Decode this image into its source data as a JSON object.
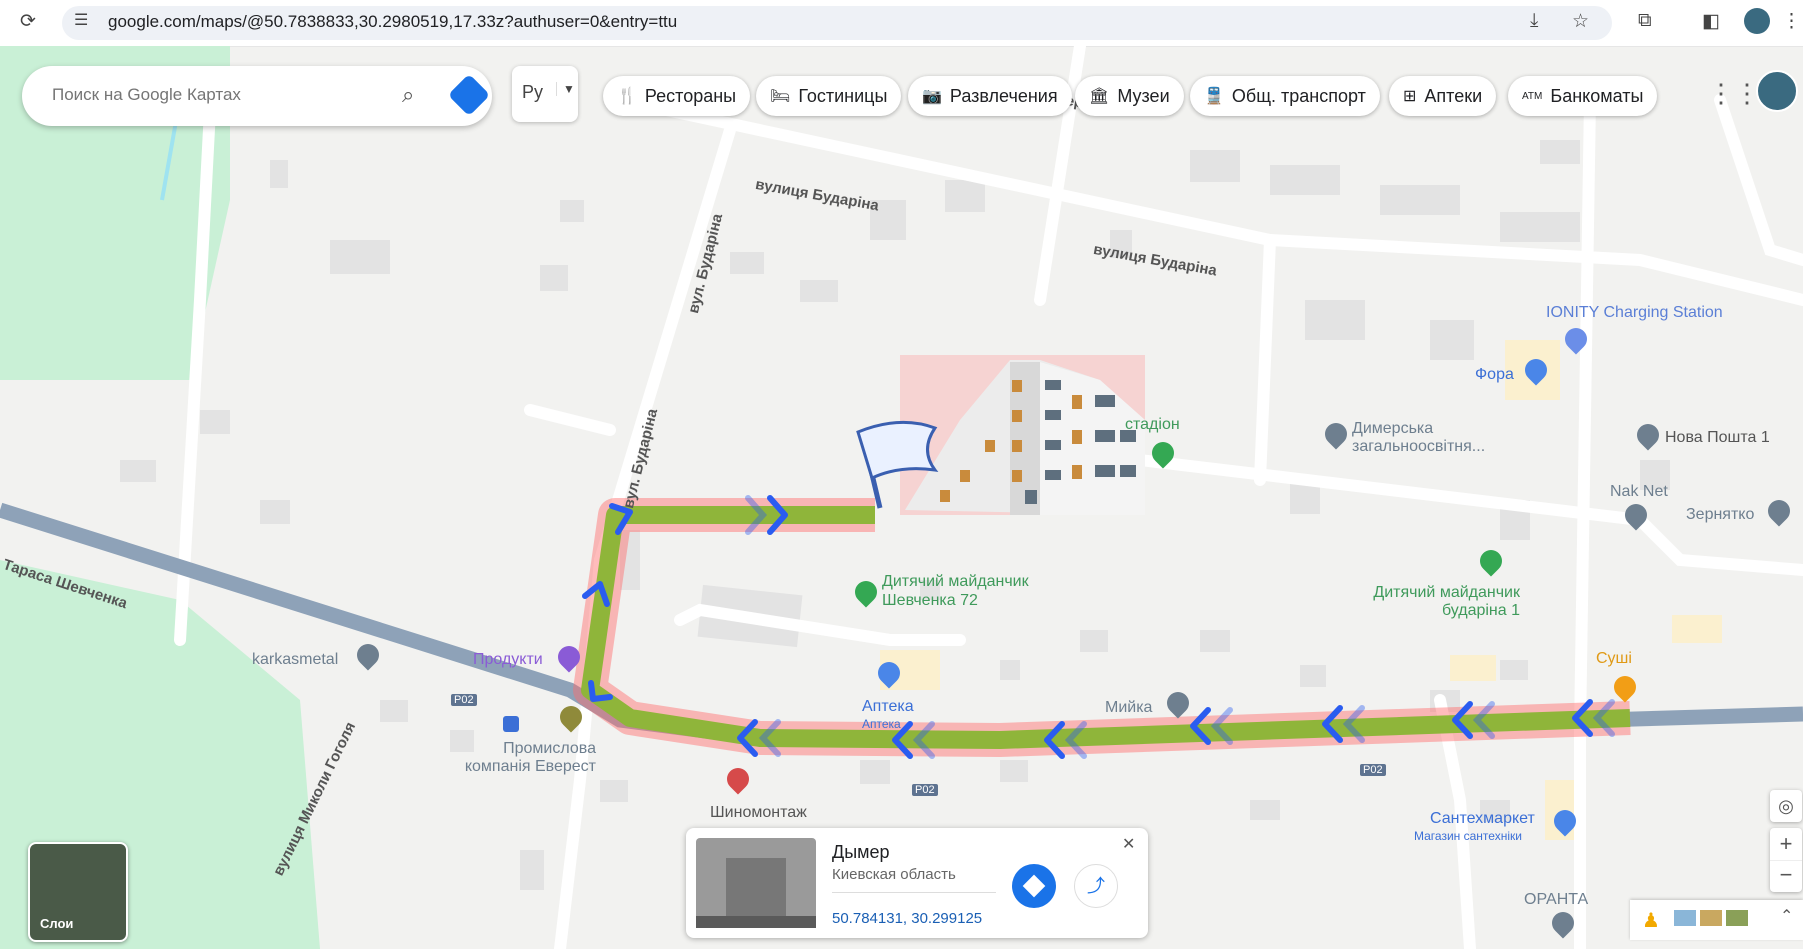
{
  "browser": {
    "url": "google.com/maps/@50.7838833,30.2980519,17.33z?authuser=0&entry=ttu"
  },
  "search": {
    "placeholder": "Поиск на Google Картах"
  },
  "lang_selector": "Ру",
  "chips": [
    {
      "icon": "utensils-icon",
      "label": "Рестораны"
    },
    {
      "icon": "bed-icon",
      "label": "Гостиницы"
    },
    {
      "icon": "camera-icon",
      "label": "Развлечения"
    },
    {
      "icon": "museum-icon",
      "label": "Музеи"
    },
    {
      "icon": "bus-icon",
      "label": "Общ. транспорт"
    },
    {
      "icon": "pharmacy-icon",
      "label": "Аптеки"
    },
    {
      "icon": "atm-icon",
      "label": "Банкоматы"
    }
  ],
  "roads": {
    "budarina_1": "вулиця Бударіна",
    "budarina_2": "вулиця Бударіна",
    "budarina_v1": "вул. Бударіна",
    "budarina_v2": "вул. Бударіна",
    "shevchenka": "Тараса Шевченка",
    "gogolya": "вулиця Миколи Гоголя",
    "highway": "P02",
    "top_cut": "ершотра"
  },
  "places": {
    "ionity": "IONITY Charging Station",
    "fora": "Фора",
    "school": "Димерська загальноосвітня...",
    "nova_poshta": "Нова Пошта 1",
    "naknet": "Nak Net",
    "zernyatko": "Зернятко",
    "stadium": "стадіон",
    "playground_a": "Дитячий майданчик Шевченка 72",
    "playground_b": "Дитячий майданчик бударіна 1",
    "sushi": "Суші",
    "karkasmetal": "karkasmetal",
    "produkty": "Продукти",
    "apteka": "Аптека",
    "apteka_sub": "Аптека",
    "myika": "Мийка",
    "everest": "Промислова компанія Еверест",
    "tyres": "Шиномонтаж",
    "santehmarket": "Сантехмаркет",
    "santehmarket_sub": "Магазин сантехніки",
    "oranta": "ОРАНТА"
  },
  "card": {
    "title": "Дымер",
    "subtitle": "Киевская область",
    "coords": "50.784131, 30.299125"
  },
  "layers_label": "Слои",
  "colors": {
    "route": "#8fb53a",
    "route_glow": "#ff8080",
    "arrows": "#2a5cf0",
    "water": "#9fe3f0",
    "park": "#c9f0d6",
    "highway": "#8ea2b8"
  }
}
